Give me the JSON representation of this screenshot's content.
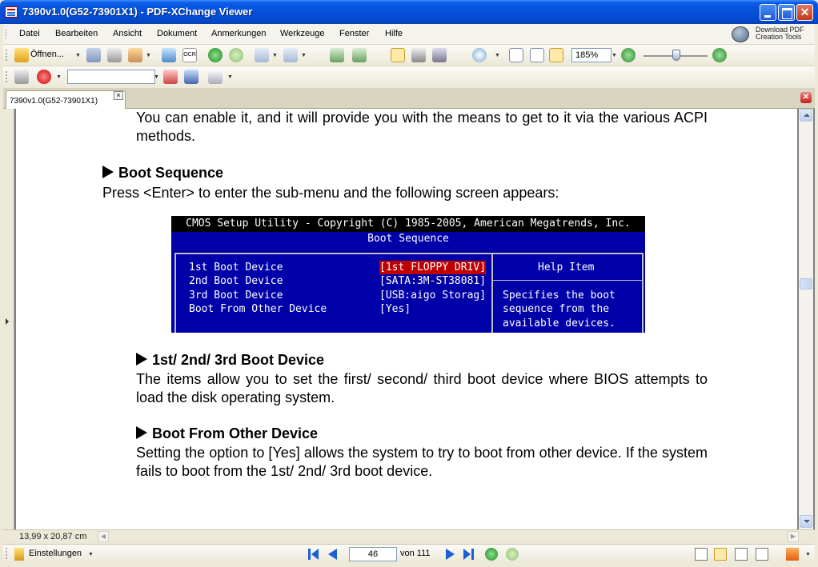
{
  "window": {
    "title": "7390v1.0(G52-73901X1) - PDF-XChange Viewer"
  },
  "menu": {
    "items": [
      "Datei",
      "Bearbeiten",
      "Ansicht",
      "Dokument",
      "Anmerkungen",
      "Werkzeuge",
      "Fenster",
      "Hilfe"
    ],
    "download_line1": "Download PDF",
    "download_line2": "Creation Tools"
  },
  "toolbar": {
    "open_label": "Öffnen...",
    "ocr_label": "OCR",
    "zoom_value": "185%"
  },
  "tabs": {
    "active": "7390v1.0(G52-73901X1)",
    "close_glyph": "×"
  },
  "document": {
    "para_acpi": "You can enable it, and it will provide you with the means to get to it via the various ACPI methods.",
    "head_boot_sequence": "Boot Sequence",
    "para_press_enter": "Press <Enter> to enter the sub-menu and the following screen appears:",
    "head_devices": "1st/ 2nd/ 3rd Boot Device",
    "para_devices": "The items allow you to set the first/ second/ third boot device where BIOS attempts to load the disk operating system.",
    "head_other": "Boot From Other Device",
    "para_other": "Setting the option to [Yes] allows the system to try to boot from other device. If the system fails to boot from the 1st/ 2nd/ 3rd boot device."
  },
  "bios": {
    "header": "CMOS Setup Utility - Copyright (C) 1985-2005, American Megatrends, Inc.",
    "subheader": "Boot Sequence",
    "rows": [
      {
        "label": "1st Boot Device",
        "value": "[1st FLOPPY DRIV]"
      },
      {
        "label": "2nd Boot Device",
        "value": "[SATA:3M-ST38081]"
      },
      {
        "label": "3rd Boot Device",
        "value": "[USB:aigo Storag]"
      },
      {
        "label": "Boot From Other Device",
        "value": "[Yes]"
      }
    ],
    "help_title": "Help Item",
    "help_lines": [
      "Specifies the boot",
      "sequence from the",
      "available devices."
    ]
  },
  "status": {
    "page_size": "13,99 x 20,87 cm",
    "settings_label": "Einstellungen",
    "current_page": "46",
    "total_pages": "von 111"
  },
  "colors": {
    "titlebar": "#0550d8",
    "bios_bg": "#0000a8",
    "bios_highlight": "#c00000"
  }
}
